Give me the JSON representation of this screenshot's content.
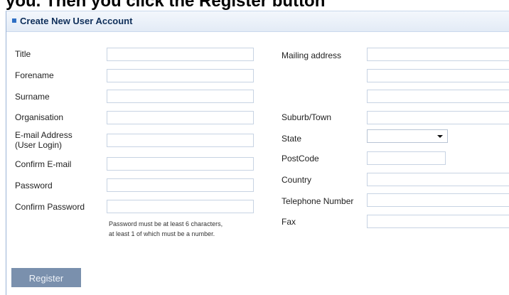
{
  "page": {
    "top_text": "you. Then you click the Register button"
  },
  "panel": {
    "title": "Create New User Account"
  },
  "left_fields": [
    {
      "label": "Title",
      "value": ""
    },
    {
      "label": "Forename",
      "value": ""
    },
    {
      "label": "Surname",
      "value": ""
    },
    {
      "label": "Organisation",
      "value": ""
    },
    {
      "label": "E-mail Address\n(User Login)",
      "value": ""
    },
    {
      "label": "Confirm E-mail",
      "value": ""
    },
    {
      "label": "Password",
      "value": ""
    },
    {
      "label": "Confirm Password",
      "value": ""
    }
  ],
  "password_note": {
    "line1": "Password must be at least 6 characters,",
    "line2": "at least 1 of which must be a number."
  },
  "right_fields": {
    "mailing_label": "Mailing address",
    "suburb_label": "Suburb/Town",
    "state_label": "State",
    "state_value": "",
    "postcode_label": "PostCode",
    "country_label": "Country",
    "telephone_label": "Telephone Number",
    "fax_label": "Fax"
  },
  "actions": {
    "register_label": "Register"
  },
  "colors": {
    "accent": "#2f6fc4",
    "button": "#7a90ad",
    "border": "#c7d3e3"
  }
}
